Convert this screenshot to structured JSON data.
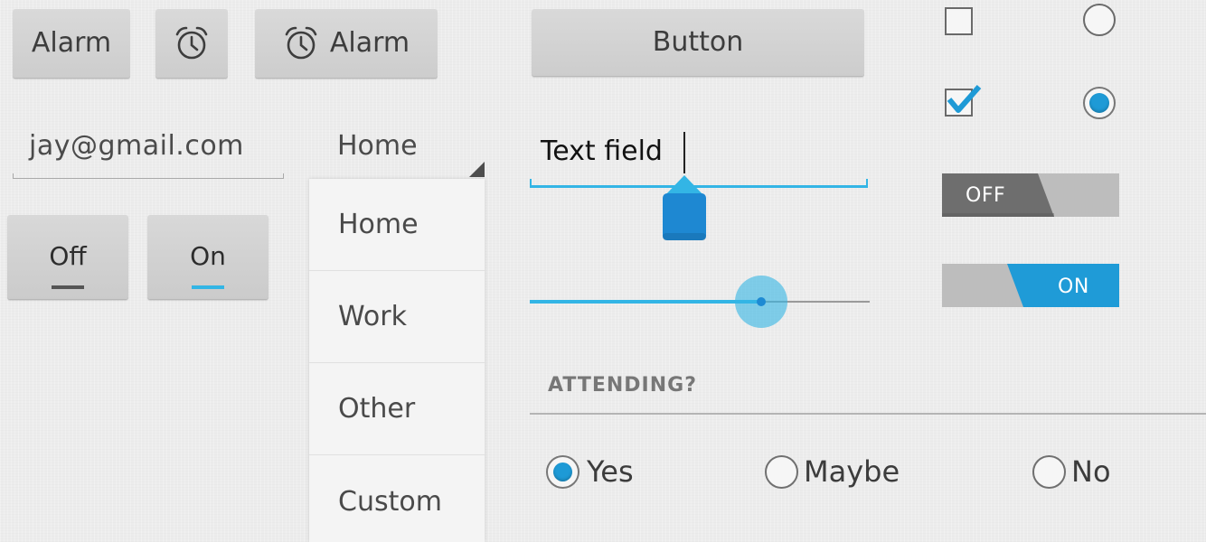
{
  "buttons": {
    "alarm_text": "Alarm",
    "alarm_icon": "alarm-clock-icon",
    "alarm_with_icon_text": "Alarm",
    "main_button": "Button"
  },
  "email_field": {
    "value": "jay@gmail.com"
  },
  "spinner": {
    "selected": "Home",
    "options": [
      "Home",
      "Work",
      "Other",
      "Custom"
    ]
  },
  "toggle_buttons": {
    "off_label": "Off",
    "on_label": "On"
  },
  "text_field": {
    "value": "Text field"
  },
  "seekbar": {
    "progress": 0.68
  },
  "checkboxes": {
    "unchecked": false,
    "checked": true
  },
  "radios": {
    "unselected": false,
    "selected": true
  },
  "switches": {
    "off_label": "OFF",
    "on_label": "ON"
  },
  "attending": {
    "header": "ATTENDING?",
    "options": [
      "Yes",
      "Maybe",
      "No"
    ],
    "selected": "Yes"
  },
  "colors": {
    "accent": "#33b5e5",
    "accent_dark": "#1e8ad3",
    "background": "#ececec",
    "button": "#d3d3d3"
  }
}
